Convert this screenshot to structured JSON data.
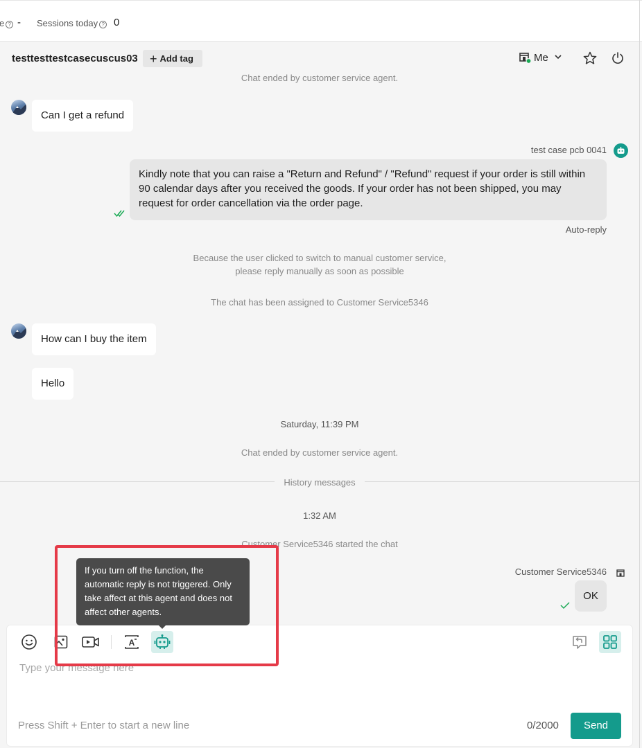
{
  "top_stats": {
    "cut_label": "e",
    "cut_value": "-",
    "sessions_label": "Sessions today",
    "sessions_value": "0"
  },
  "header": {
    "customer_name": "testtesttestcasecuscus03",
    "add_tag_label": "Add tag",
    "assignee": "Me"
  },
  "messages": {
    "system_ended_1": "Chat ended by customer service agent.",
    "customer_msg_1": "Can I get a refund",
    "bot_sender": "test case pcb 0041",
    "auto_reply_text": "Kindly note that you can raise a \"Return and Refund\" / \"Refund\" request if your order is still within 90 calendar days after you received the goods. If your order has not been shipped, you may request for order cancellation via the order page.",
    "auto_reply_label": "Auto-reply",
    "system_switch_line1": "Because the user clicked to switch to manual customer service,",
    "system_switch_line2": "please reply manually as soon as possible",
    "system_assigned": "The chat has been assigned to Customer Service5346",
    "customer_msg_2": "How can I buy the item",
    "customer_msg_3": "Hello",
    "date_divider": "Saturday, 11:39 PM",
    "system_ended_2": "Chat ended by customer service agent.",
    "history_divider": "History messages",
    "time_divider": "1:32 AM",
    "system_started": "Customer Service5346 started the chat",
    "agent_sender": "Customer Service5346",
    "agent_msg": "OK"
  },
  "tooltip": {
    "text": "If you turn off the function, the automatic reply is not triggered. Only take affect at this agent and does not affect other agents."
  },
  "composer": {
    "placeholder": "Type your message here",
    "hint": "Press Shift + Enter to start a new line",
    "counter": "0/2000",
    "send_label": "Send"
  },
  "colors": {
    "accent": "#149b8c",
    "highlight_border": "#e53a48",
    "online_dot": "#1aaa55"
  }
}
